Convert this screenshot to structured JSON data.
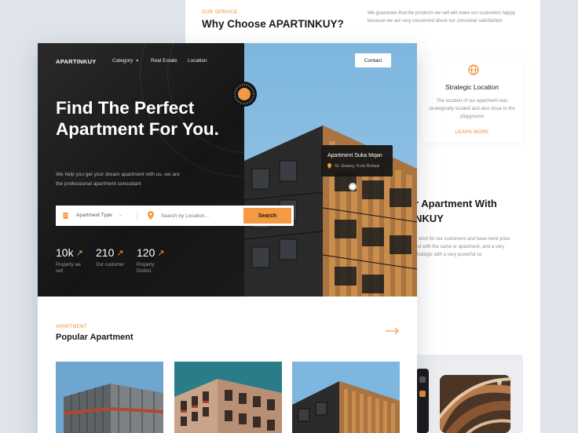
{
  "back": {
    "eyebrow": "OUR SERVICE",
    "title": "Why Choose APARTINKUY?",
    "description": "We guarantee that the products we sell will make our customers happy because we are very concerned about our consumer satisfaction",
    "feature": {
      "icon": "globe-icon",
      "title": "Strategic Location",
      "description": "The location of our apartment was strategically located and also close to the playground",
      "link": "LEARN MORE"
    },
    "heading_line1": "r Apartment With",
    "heading_line2": "NKUY",
    "paragraph": "a wish for our customers and have ment price but with the same ur apartment, and a very strategic with a very powerful ce"
  },
  "nav": {
    "logo": "APARTINKUY",
    "items": [
      "Category",
      "Real Estate",
      "Location"
    ],
    "contact": "Contact"
  },
  "hero": {
    "title": "Find The Perfect Apartment For You.",
    "subtitle": "We help you get your dream apartment with us, we are the professional apartment consultant"
  },
  "search": {
    "type_label": "Apartment Type",
    "location_placeholder": "Search by Location...",
    "button": "Search"
  },
  "stats": [
    {
      "value": "10k",
      "label": "Property we sell"
    },
    {
      "value": "210",
      "label": "Our customer"
    },
    {
      "value": "120",
      "label": "Property District"
    }
  ],
  "building_card": {
    "name": "Apartment Suka Mqan",
    "address": "St. Galaxy, Kota Bekasi"
  },
  "popular": {
    "eyebrow": "APARTMENT",
    "title": "Popular Apartment"
  },
  "colors": {
    "accent": "#f39a42",
    "dark": "#161616",
    "sky": "#7fb4d8"
  }
}
